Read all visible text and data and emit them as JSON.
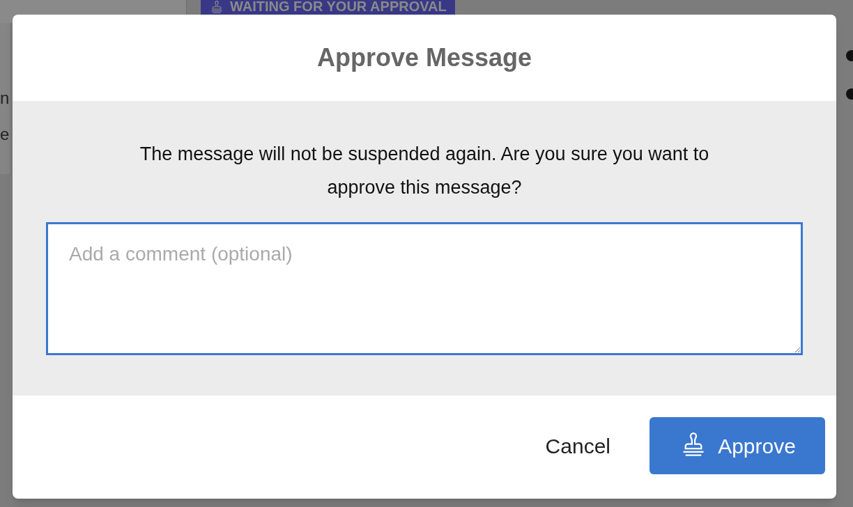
{
  "background": {
    "banner": "WAITING FOR YOUR APPROVAL",
    "fragments": [
      "n",
      "e"
    ]
  },
  "dialog": {
    "title": "Approve Message",
    "message": "The message will not be suspended again. Are you sure you want to approve this message?",
    "comment": {
      "placeholder": "Add a comment (optional)"
    },
    "buttons": [
      {
        "label": "Cancel",
        "kind": "secondary"
      },
      {
        "label": "Approve",
        "kind": "primary"
      }
    ]
  }
}
